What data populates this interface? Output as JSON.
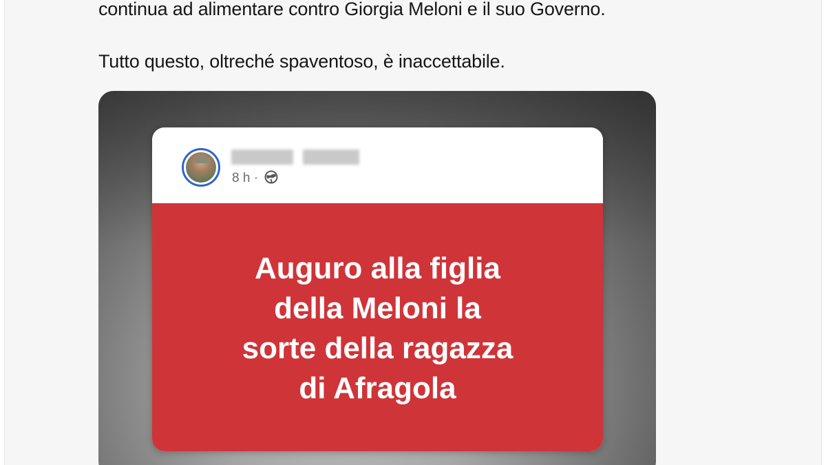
{
  "tweet": {
    "line1": "continua ad alimentare contro Giorgia Meloni e il suo Governo.",
    "line2": "Tutto questo, oltreché spaventoso, è inaccettabile."
  },
  "embedded_post": {
    "author_name_visible": "",
    "time": "8 h",
    "separator": "·",
    "privacy_icon": "globe-icon",
    "message_lines": [
      "Auguro alla figlia",
      "della Meloni la",
      "sorte della ragazza",
      "di Afragola"
    ]
  },
  "colors": {
    "post_background": "#cf3439",
    "avatar_ring": "#2f63c9",
    "page_background": "#f6f6f6",
    "text": "#161616"
  }
}
